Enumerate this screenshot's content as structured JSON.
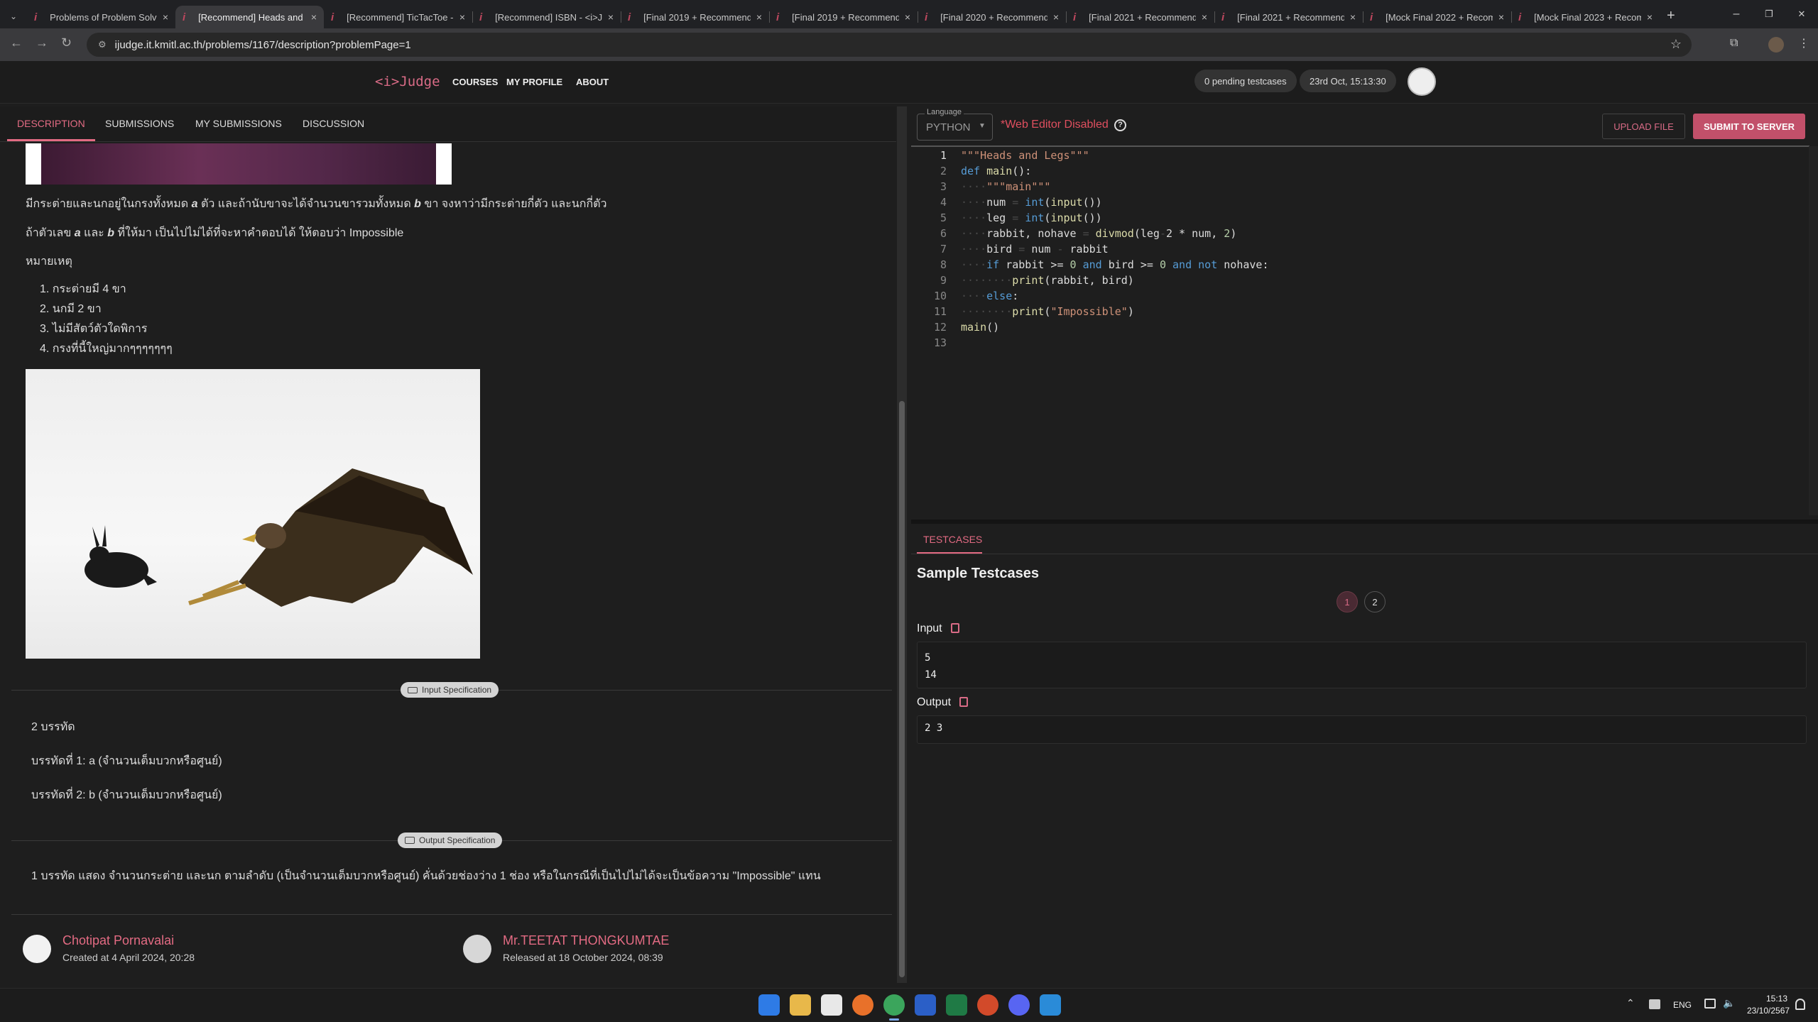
{
  "browser": {
    "tabs": [
      {
        "label": "Problems of Problem Solv"
      },
      {
        "label": "[Recommend] Heads and",
        "active": true
      },
      {
        "label": "[Recommend] TicTacToe -"
      },
      {
        "label": "[Recommend] ISBN - <i>J"
      },
      {
        "label": "[Final 2019 + Recommend"
      },
      {
        "label": "[Final 2019 + Recommend"
      },
      {
        "label": "[Final 2020 + Recommend"
      },
      {
        "label": "[Final 2021 + Recommend"
      },
      {
        "label": "[Final 2021 + Recommend"
      },
      {
        "label": "[Mock Final 2022 + Recom"
      },
      {
        "label": "[Mock Final 2023 + Recom"
      }
    ],
    "favicon": "i",
    "close_glyph": "×",
    "new_tab": "+",
    "url": "ijudge.it.kmitl.ac.th/problems/1167/description?problemPage=1",
    "window_controls": [
      "–",
      "❐",
      "✕"
    ]
  },
  "app": {
    "logo": "<i>Judge",
    "nav": [
      "COURSES",
      "MY PROFILE",
      "ABOUT"
    ],
    "pending": "0 pending testcases",
    "datetime": "23rd Oct, 15:13:30"
  },
  "left": {
    "tabs": [
      "DESCRIPTION",
      "SUBMISSIONS",
      "MY SUBMISSIONS",
      "DISCUSSION"
    ],
    "para1": [
      "มีกระต่ายและนกอยู่ในกรงทั้งหมด ",
      "a",
      " ตัว และถ้านับขาจะได้จำนวนขารวมทั้งหมด ",
      "b",
      " ขา จงหาว่ามีกระต่ายกี่ตัว และนกกี่ตัว"
    ],
    "para2": [
      "ถ้าตัวเลข ",
      "a",
      " และ ",
      "b",
      " ที่ให้มา เป็นไปไม่ได้ที่จะหาคำตอบได้ ให้ตอบว่า Impossible"
    ],
    "note_title": "หมายเหตุ",
    "notes": [
      "1. กระต่ายมี 4 ขา",
      "2. นกมี 2 ขา",
      "3. ไม่มีสัตว์ตัวใดพิการ",
      "4. กรงที่นี้ใหญ่มากๆๆๆๆๆๆๆ"
    ],
    "input_spec_label": "Input Specification",
    "input_lines": [
      "2 บรรทัด",
      "บรรทัดที่ 1: a (จำนวนเต็มบวกหรือศูนย์)",
      "บรรทัดที่ 2: b (จำนวนเต็มบวกหรือศูนย์)"
    ],
    "output_spec_label": "Output Specification",
    "output_line": "1 บรรทัด แสดง จำนวนกระต่าย และนก ตามลำดับ (เป็นจำนวนเต็มบวกหรือศูนย์) คั่นด้วยช่องว่าง 1 ช่อง หรือในกรณีที่เป็นไปไม่ได้จะเป็นข้อความ \"Impossible\" แทน",
    "creator": {
      "name": "Chotipat Pornavalai",
      "meta": "Created at 4 April 2024, 20:28"
    },
    "releaser": {
      "name": "Mr.TEETAT THONGKUMTAE",
      "meta": "Released at 18 October 2024, 08:39"
    }
  },
  "editor": {
    "language_label": "Language",
    "language": "PYTHON",
    "disabled_text": "*Web Editor Disabled",
    "upload_label": "UPLOAD FILE",
    "submit_label": "SUBMIT TO SERVER",
    "line_numbers": [
      "1",
      "2",
      "3",
      "4",
      "5",
      "6",
      "7",
      "8",
      "9",
      "10",
      "11",
      "12",
      "13"
    ]
  },
  "testcases": {
    "tab": "TESTCASES",
    "title": "Sample Testcases",
    "pages": [
      "1",
      "2"
    ],
    "current_page": "1",
    "input_label": "Input",
    "input_lines": [
      "5",
      "14"
    ],
    "output_label": "Output",
    "output_value": "2 3"
  },
  "taskbar": {
    "lang": "ENG",
    "time": "15:13",
    "date": "23/10/2567"
  }
}
